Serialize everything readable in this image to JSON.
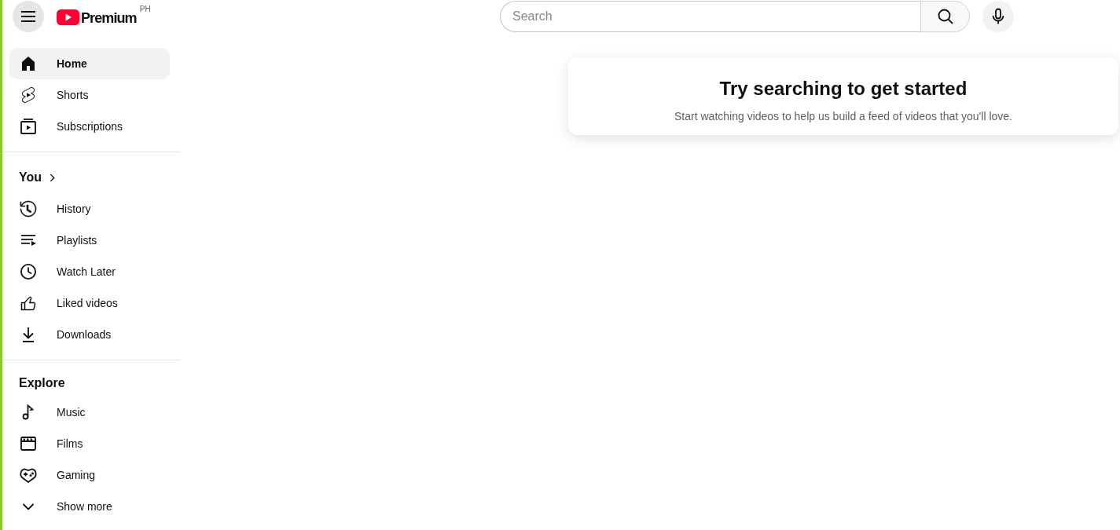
{
  "header": {
    "logo": {
      "wordmark": "Premium",
      "country": "PH"
    },
    "search": {
      "placeholder": "Search"
    }
  },
  "sidebar": {
    "sections": [
      {
        "items": [
          {
            "kind": "home",
            "label": "Home",
            "selected": true
          },
          {
            "kind": "shorts",
            "label": "Shorts",
            "selected": false
          },
          {
            "kind": "subscriptions",
            "label": "Subscriptions",
            "selected": false
          }
        ]
      },
      {
        "title": {
          "text": "You",
          "link": true
        },
        "items": [
          {
            "kind": "history",
            "label": "History",
            "selected": false
          },
          {
            "kind": "playlists",
            "label": "Playlists",
            "selected": false
          },
          {
            "kind": "watch_later",
            "label": "Watch Later",
            "selected": false
          },
          {
            "kind": "liked",
            "label": "Liked videos",
            "selected": false
          },
          {
            "kind": "downloads",
            "label": "Downloads",
            "selected": false
          }
        ]
      },
      {
        "title": {
          "text": "Explore",
          "link": false
        },
        "items": [
          {
            "kind": "music",
            "label": "Music",
            "selected": false
          },
          {
            "kind": "films",
            "label": "Films",
            "selected": false
          },
          {
            "kind": "gaming",
            "label": "Gaming",
            "selected": false
          },
          {
            "kind": "more",
            "label": "Show more",
            "selected": false
          }
        ]
      }
    ]
  },
  "feed_prompt": {
    "title": "Try searching to get started",
    "message": "Start watching videos to help us build a feed of videos that you'll love."
  }
}
